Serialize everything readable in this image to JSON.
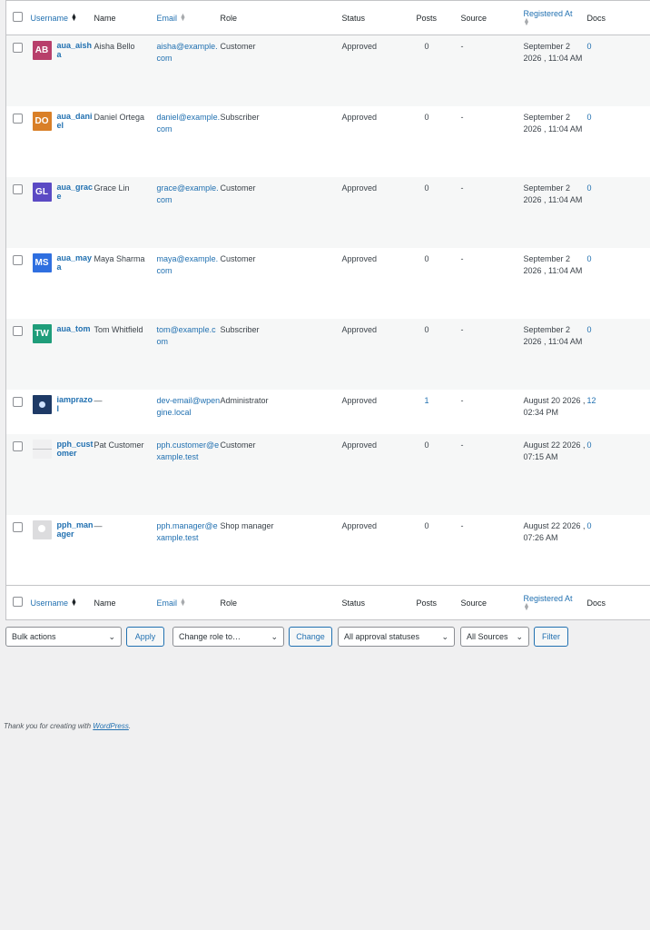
{
  "columns": {
    "username": "Username",
    "name": "Name",
    "email": "Email",
    "role": "Role",
    "status": "Status",
    "posts": "Posts",
    "source": "Source",
    "registered": "Registered At",
    "docs": "Docs"
  },
  "users": [
    {
      "initials": "AB",
      "avatar_color": "#b83f6b",
      "username": "aua_aisha",
      "name": "Aisha Bello",
      "email": "aisha@example.com",
      "role": "Customer",
      "status": "Approved",
      "posts": "0",
      "source": "-",
      "registered": "September 2 2026 , 11:04 AM",
      "docs": "0"
    },
    {
      "initials": "DO",
      "avatar_color": "#d97f27",
      "username": "aua_daniel",
      "name": "Daniel Ortega",
      "email": "daniel@example.com",
      "role": "Subscriber",
      "status": "Approved",
      "posts": "0",
      "source": "-",
      "registered": "September 2 2026 , 11:04 AM",
      "docs": "0"
    },
    {
      "initials": "GL",
      "avatar_color": "#5b4ac4",
      "username": "aua_grace",
      "name": "Grace Lin",
      "email": "grace@example.com",
      "role": "Customer",
      "status": "Approved",
      "posts": "0",
      "source": "-",
      "registered": "September 2 2026 , 11:04 AM",
      "docs": "0"
    },
    {
      "initials": "MS",
      "avatar_color": "#2f6fe0",
      "username": "aua_maya",
      "name": "Maya Sharma",
      "email": "maya@example.com",
      "role": "Customer",
      "status": "Approved",
      "posts": "0",
      "source": "-",
      "registered": "September 2 2026 , 11:04 AM",
      "docs": "0"
    },
    {
      "initials": "TW",
      "avatar_color": "#1f9d7a",
      "username": "aua_tom",
      "name": "Tom Whitfield",
      "email": "tom@example.com",
      "role": "Subscriber",
      "status": "Approved",
      "posts": "0",
      "source": "-",
      "registered": "September 2 2026 , 11:04 AM",
      "docs": "0"
    },
    {
      "initials": "",
      "avatar_color": "#1e3a66",
      "username": "iamprazol",
      "name": "—",
      "email": "dev-email@wpengine.local",
      "role": "Administrator",
      "status": "Approved",
      "posts": "1",
      "source": "-",
      "registered": "August 20 2026 , 02:34 PM",
      "docs": "12"
    },
    {
      "initials": "",
      "avatar_color": "#f0f0f1",
      "username": "pph_customer",
      "name": "Pat Customer",
      "email": "pph.customer@example.test",
      "role": "Customer",
      "status": "Approved",
      "posts": "0",
      "source": "-",
      "registered": "August 22 2026 , 07:15 AM",
      "docs": "0"
    },
    {
      "initials": "",
      "avatar_color": "#dcdcde",
      "username": "pph_manager",
      "name": "—",
      "email": "pph.manager@example.test",
      "role": "Shop manager",
      "status": "Approved",
      "posts": "0",
      "source": "-",
      "registered": "August 22 2026 , 07:26 AM",
      "docs": "0"
    }
  ],
  "tablenav": {
    "bulk_actions": "Bulk actions",
    "apply": "Apply",
    "change_role": "Change role to…",
    "change": "Change",
    "approval_statuses": "All approval statuses",
    "sources": "All Sources",
    "filter": "Filter"
  },
  "footer": {
    "text": "Thank you for creating with",
    "link": "WordPress",
    "end": "."
  }
}
